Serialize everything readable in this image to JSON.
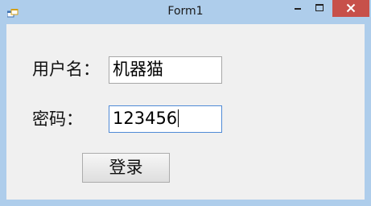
{
  "window": {
    "title": "Form1",
    "icons": {
      "app": "app-icon",
      "minimize": "minimize-icon",
      "maximize": "maximize-icon",
      "close": "close-icon"
    },
    "colors": {
      "frame": "#aecdeb",
      "client": "#f0f0f0",
      "close_button": "#c7504a",
      "focus_border": "#4f8ad6"
    }
  },
  "form": {
    "username_label": "用户名：",
    "username_value": "机器猫",
    "password_label": "密码：",
    "password_value": "123456",
    "login_label": "登录"
  }
}
